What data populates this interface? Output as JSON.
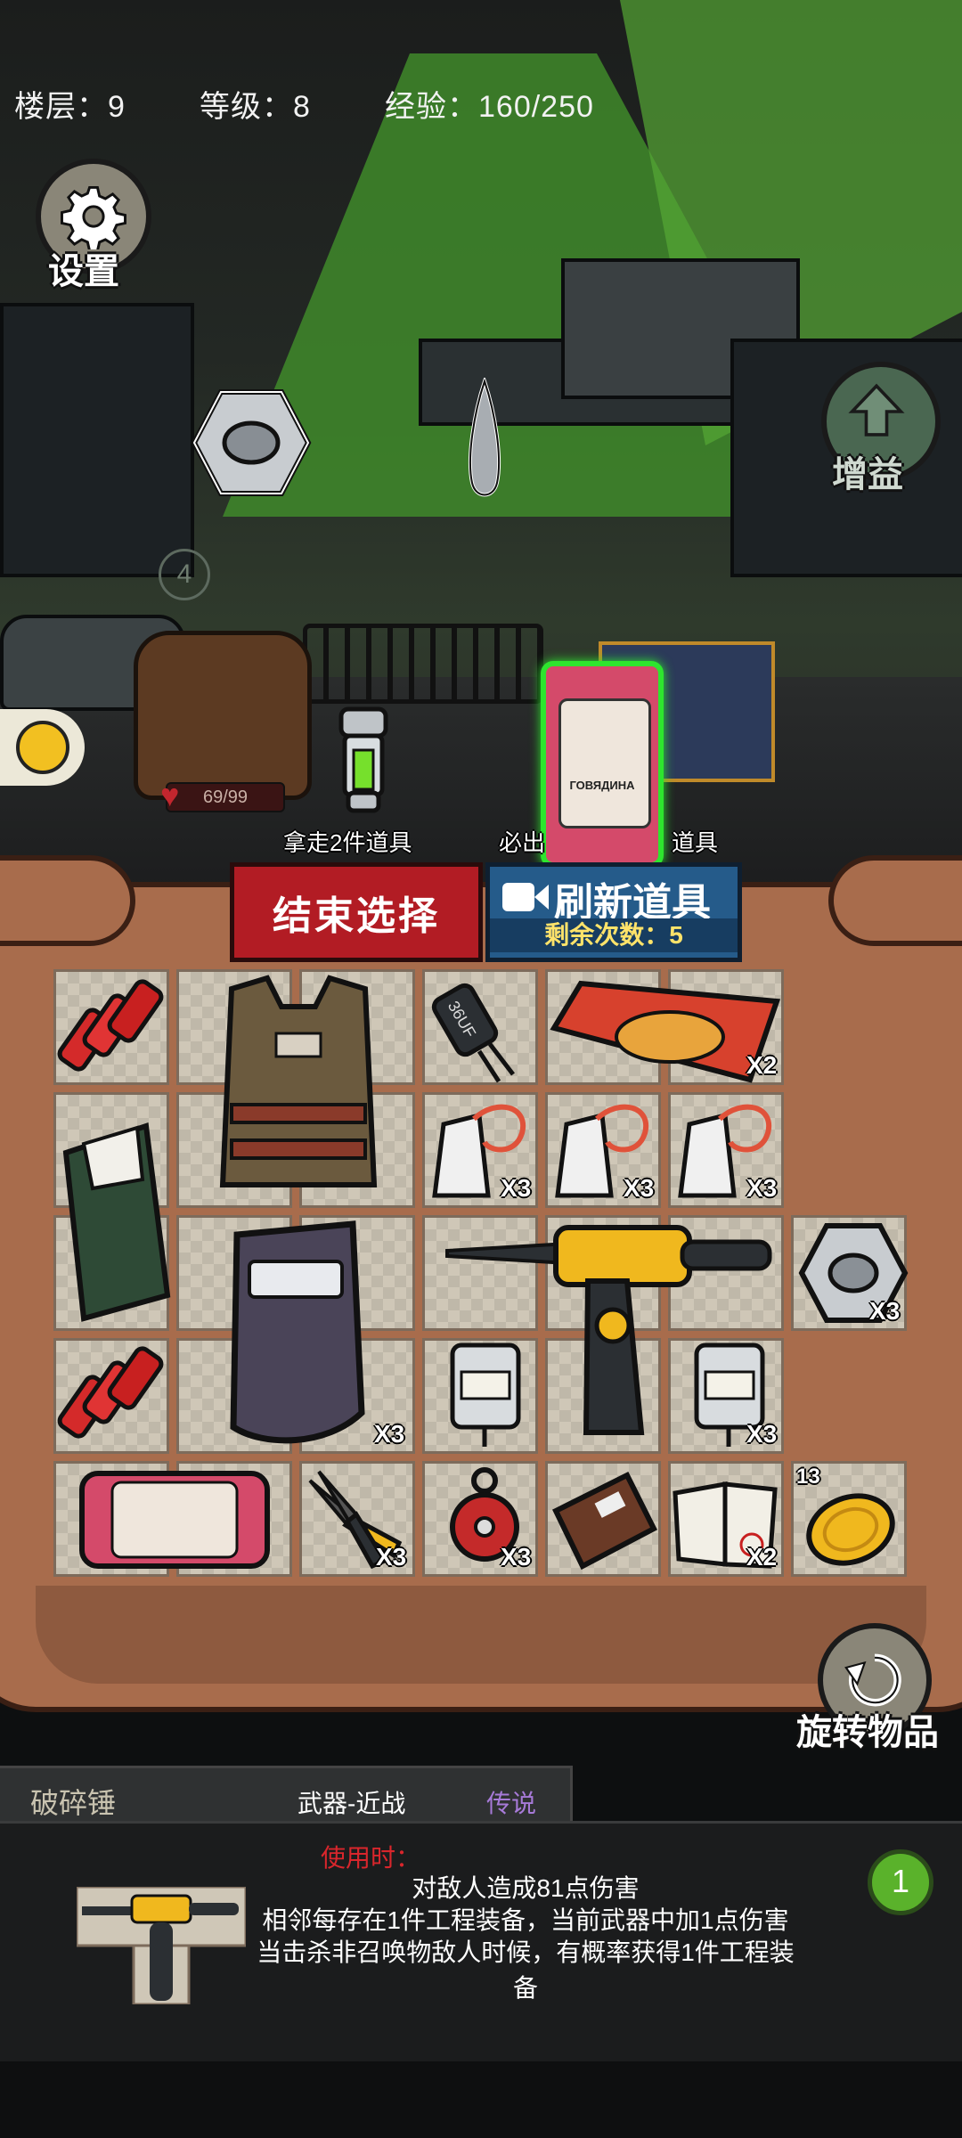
{
  "stats": {
    "floor": "楼层：9",
    "level": "等级：8",
    "exp": "经验：160/250"
  },
  "buttons": {
    "settings": "设置",
    "boost": "增益",
    "end_select": "结束选择",
    "refresh": "刷新道具",
    "refresh_remaining": "剩余次数：5",
    "rotate": "旋转物品"
  },
  "scene": {
    "enemy_level": "4",
    "hp": "69/99",
    "offer_take_caption": "拿走2件道具",
    "offer_must_caption_left": "必出",
    "offer_must_caption_right": "道具"
  },
  "inventory": {
    "qty_noodles": "X2",
    "qty_tag1": "X3",
    "qty_tag2": "X3",
    "qty_tag3": "X3",
    "qty_nut": "X3",
    "qty_shield": "X3",
    "qty_meter2": "X3",
    "qty_pliers": "X3",
    "qty_pulley": "X3",
    "qty_paper": "X2",
    "coin_count": "13",
    "capacitor_label": "36UF",
    "can_label": "ГОВЯДИНА"
  },
  "item_info": {
    "name": "破碎锤",
    "category": "武器-近战",
    "rarity": "传说",
    "use_when": "使用时：",
    "effect1": "对敌人造成81点伤害",
    "effect2": "相邻每存在1件工程装备，当前武器中加1点伤害",
    "effect3": "当击杀非召唤物敌人时候，有概率获得1件工程装备",
    "level": "1"
  },
  "colors": {
    "rarity": "#a77ad8",
    "use_when": "#d9262c",
    "end_button": "#b21c24",
    "refresh_button": "#255b8a",
    "highlight_green": "#2ee52e"
  }
}
